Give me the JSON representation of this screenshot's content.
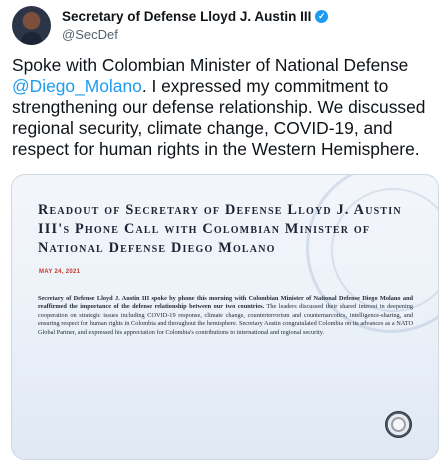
{
  "author": {
    "name": "Secretary of Defense Lloyd J. Austin III",
    "handle": "@SecDef",
    "verified_icon": "verified-badge-icon"
  },
  "tweet": {
    "text_before": "Spoke with Colombian Minister of National Defense ",
    "mention": "@Diego_Molano",
    "text_after": ". I expressed my commitment to strengthening our defense relationship. We discussed regional security, climate change, COVID-19, and respect for human rights in the Western Hemisphere."
  },
  "card": {
    "title": "Readout of Secretary of Defense Lloyd J. Austin III's Phone Call with Colombian Minister of National Defense Diego Molano",
    "date": "MAY 24, 2021",
    "body_bold": "Secretary of Defense Lloyd J. Austin III spoke by phone this morning with Colombian Minister of National Defense Diego Molano and reaffirmed the importance of the defense relationship between our two countries.",
    "body_rest": " The leaders discussed their shared interest in deepening cooperation on strategic issues including COVID-19 response, climate change, counterterrorism and counternarcotics, intelligence-sharing, and ensuring respect for human rights in Colombia and throughout the hemisphere. Secretary Austin congratulated Colombia on its advances as a NATO Global Partner, and expressed his appreciation for Colombia's contributions to international and regional security."
  },
  "colors": {
    "accent": "#1d9bf0",
    "text": "#0f1419",
    "muted": "#536471",
    "date": "#c0392b"
  }
}
